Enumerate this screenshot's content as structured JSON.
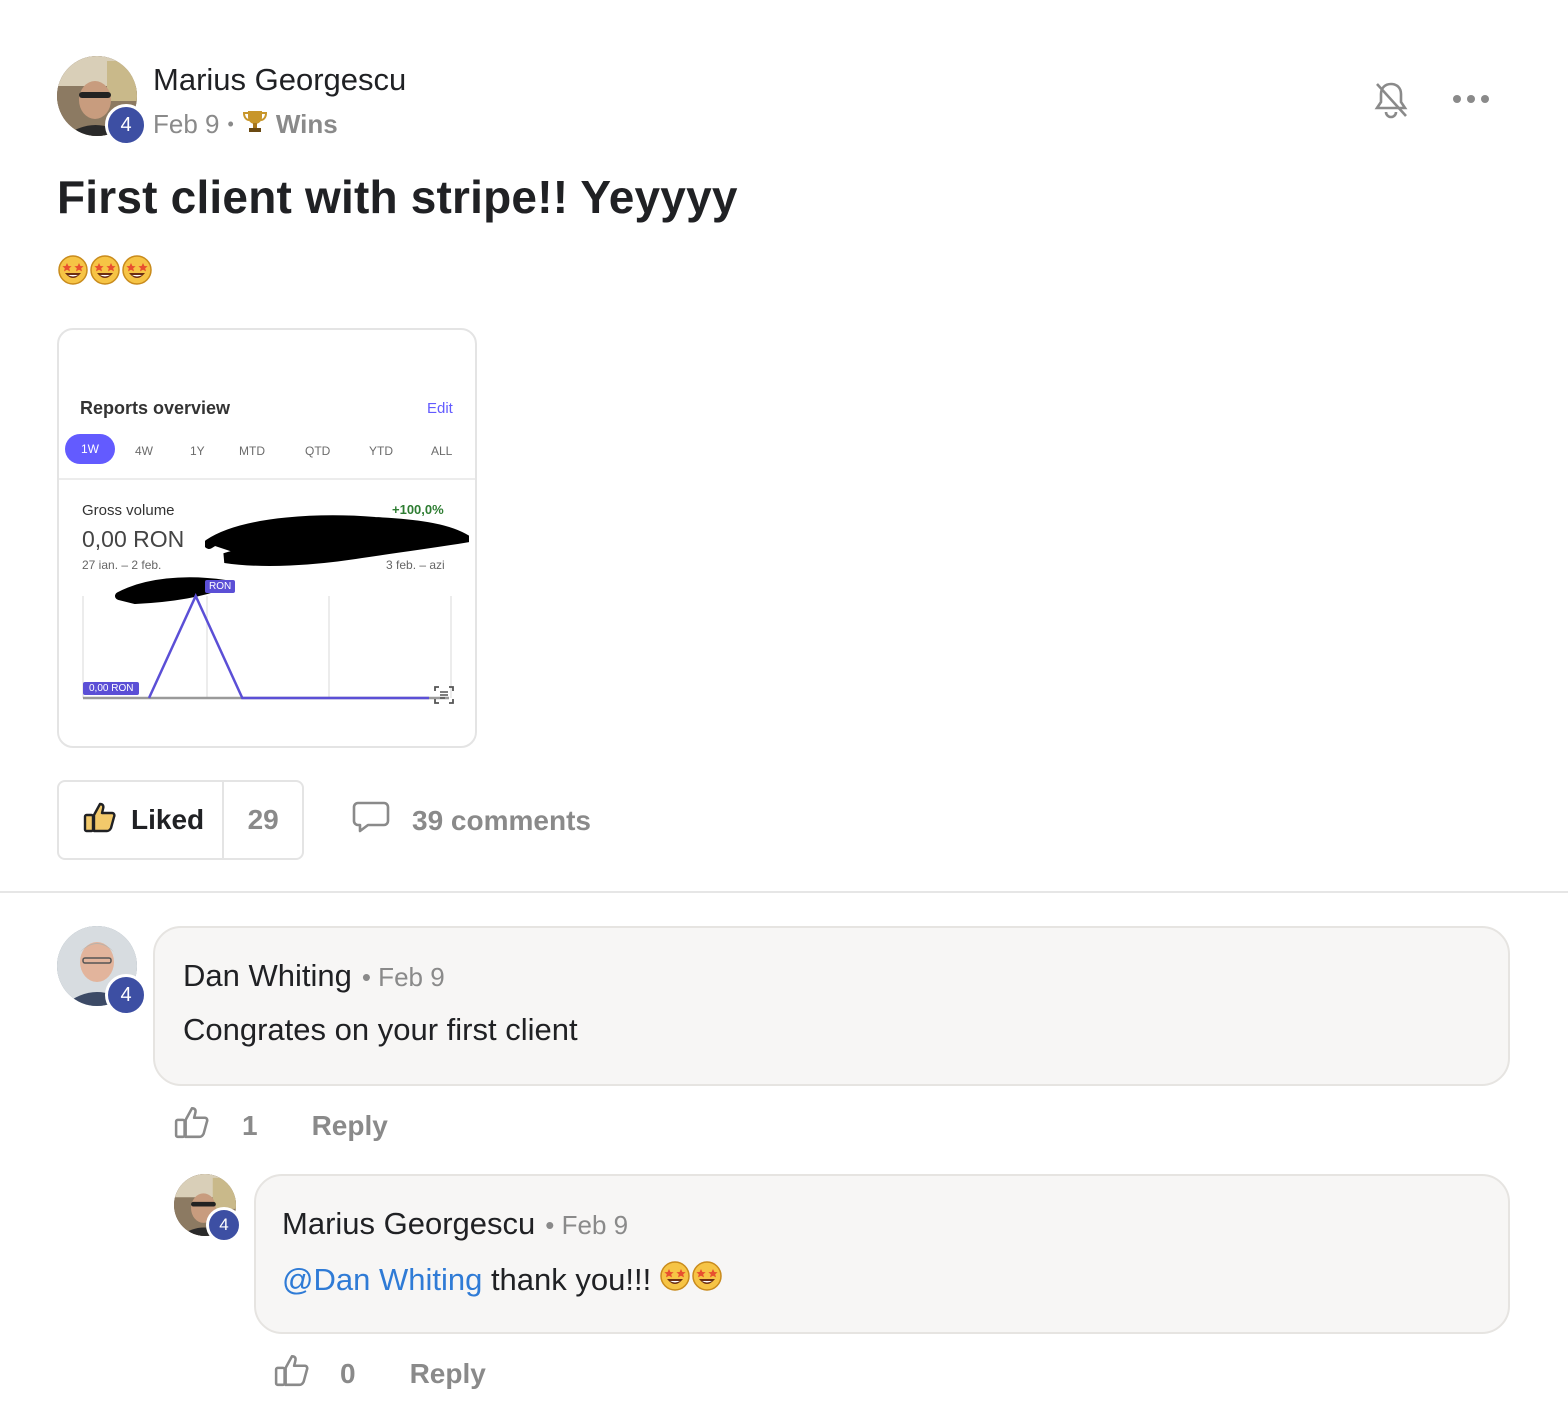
{
  "post": {
    "author": "Marius Georgescu",
    "level": "4",
    "date": "Feb 9",
    "separator": "•",
    "category_icon": "trophy-icon",
    "category": "Wins",
    "title": "First client with stripe!! Yeyyyy",
    "body_emojis": [
      "star-struck",
      "star-struck",
      "star-struck"
    ]
  },
  "attachment": {
    "heading": "Reports overview",
    "edit_label": "Edit",
    "ranges": [
      "1W",
      "4W",
      "1Y",
      "MTD",
      "QTD",
      "YTD",
      "ALL"
    ],
    "active_range": "1W",
    "metric_label": "Gross volume",
    "change": "+100,0%",
    "previous_value": "0,00 RON",
    "previous_period": "27 ian. – 2 feb.",
    "current_period": "3 feb. – azi",
    "peak_tag": "RON",
    "base_tag": "0,00 RON",
    "chart_colors": {
      "line": "#5b4fd6",
      "previous": "#9a9a9a"
    }
  },
  "chart_data": {
    "type": "line",
    "title": "Gross volume",
    "series": [
      {
        "values": [
          0,
          1,
          0,
          0,
          0,
          0,
          0
        ]
      }
    ]
  },
  "actions": {
    "like_icon": "thumbs-up-icon",
    "like_label": "Liked",
    "like_count": "29",
    "comment_icon": "speech-bubble-icon",
    "comments_label": "39 comments"
  },
  "header_icons": [
    "bell-off-icon",
    "more-dots-icon"
  ],
  "comments": [
    {
      "author": "Dan Whiting",
      "level": "4",
      "date": "• Feb 9",
      "text": "Congrates on your first client",
      "likes": "1",
      "reply_label": "Reply"
    }
  ],
  "replies": [
    {
      "author": "Marius Georgescu",
      "level": "4",
      "date": "• Feb 9",
      "mention": "@Dan Whiting",
      "text": " thank you!!!",
      "emojis": [
        "star-struck",
        "star-struck"
      ],
      "likes": "0",
      "reply_label": "Reply"
    }
  ]
}
